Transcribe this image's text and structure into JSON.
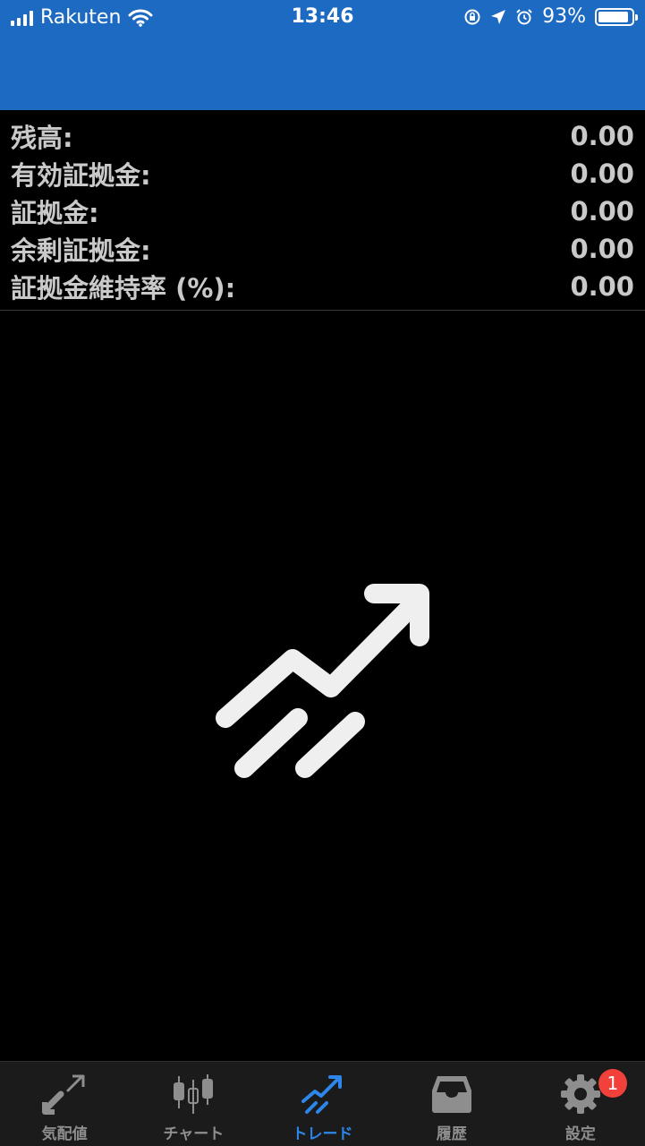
{
  "status_bar": {
    "carrier": "Rakuten",
    "time": "13:46",
    "battery_percent": "93%",
    "battery_level": 0.93
  },
  "colors": {
    "header_blue": "#1d6ac2",
    "active_tab": "#2d86ea",
    "inactive_tab": "#8e8e8e",
    "badge": "#f2413b"
  },
  "account": {
    "rows": [
      {
        "label": "残高:",
        "value": "0.00"
      },
      {
        "label": "有効証拠金:",
        "value": "0.00"
      },
      {
        "label": "証拠金:",
        "value": "0.00"
      },
      {
        "label": "余剰証拠金:",
        "value": "0.00"
      },
      {
        "label": "証拠金維持率 (%):",
        "value": "0.00"
      }
    ]
  },
  "empty_state": {
    "icon": "trend-up-arrow-icon"
  },
  "tabs": [
    {
      "label": "気配値",
      "icon": "quotes-icon",
      "active": false
    },
    {
      "label": "チャート",
      "icon": "candlestick-icon",
      "active": false
    },
    {
      "label": "トレード",
      "icon": "trade-icon",
      "active": true
    },
    {
      "label": "履歴",
      "icon": "history-inbox-icon",
      "active": false
    },
    {
      "label": "設定",
      "icon": "gear-icon",
      "active": false,
      "badge": "1"
    }
  ]
}
